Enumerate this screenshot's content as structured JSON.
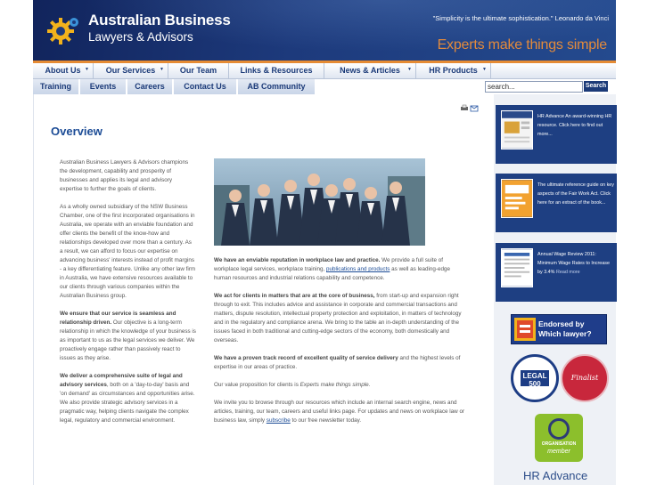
{
  "header": {
    "brand_line1": "Australian Business",
    "brand_line2": "Lawyers & Advisors",
    "quote": "\"Simplicity is the ultimate sophistication.\" Leonardo da Vinci",
    "tagline": "Experts make things simple"
  },
  "nav_primary": [
    {
      "label": "About Us",
      "has_dropdown": true
    },
    {
      "label": "Our Services",
      "has_dropdown": true
    },
    {
      "label": "Our Team",
      "has_dropdown": false
    },
    {
      "label": "Links & Resources",
      "has_dropdown": false
    },
    {
      "label": "News & Articles",
      "has_dropdown": true
    },
    {
      "label": "HR Products",
      "has_dropdown": true
    }
  ],
  "nav_secondary": [
    {
      "label": "Training"
    },
    {
      "label": "Events"
    },
    {
      "label": "Careers"
    },
    {
      "label": "Contact Us"
    },
    {
      "label": "AB Community"
    }
  ],
  "search": {
    "value": "search...",
    "button": "Search"
  },
  "page": {
    "title": "Overview",
    "left_paragraphs": [
      "Australian Business Lawyers & Advisors champions the development, capability and prosperity of businesses and applies its legal and advisory expertise to further the goals of clients.",
      "As a wholly owned subsidiary of the NSW Business Chamber, one of the first incorporated organisations in Australia, we operate with an enviable foundation and offer clients the benefit of the know-how and relationships developed over more than a century. As a result, we can afford to focus our expertise on advancing business' interests instead of profit margins - a key differentiating feature. Unlike any other law firm in Australia, we have extensive resources available to our clients through various companies within the Australian Business group."
    ],
    "left_p3_bold": "We ensure that our service is seamless and relationship driven.",
    "left_p3_rest": " Our objective is a long-term relationship in which the knowledge of your business is as important to us as the legal services we deliver. We proactively engage rather than passively react to issues as they arise.",
    "left_p4_bold": "We deliver a comprehensive suite of legal and advisory services",
    "left_p4_rest": ", both on a 'day-to-day' basis and 'on demand' as circumstances and opportunities arise. We also provide strategic advisory services in a pragmatic way, helping clients navigate the complex legal, regulatory and commercial environment.",
    "right_p1_bold": "We have an enviable reputation in workplace law and practice.",
    "right_p1_a": " We provide a full suite of workplace legal services, workplace training, ",
    "right_p1_link": "publications and products",
    "right_p1_b": " as well as leading-edge human resources and industrial relations capability and competence.",
    "right_p2_bold": "We act for clients in matters that are at the core of business,",
    "right_p2_rest": " from start-up and expansion right through to exit. This includes advice and assistance in corporate and commercial transactions and matters, dispute resolution, intellectual property protection and exploitation, in matters of technology and in the regulatory and compliance arena. We bring to the table an in-depth understanding of the issues faced in both traditional and cutting-edge sectors of the economy, both domestically and overseas.",
    "right_p3_bold": "We have a proven track record of excellent quality of service delivery",
    "right_p3_rest": " and the highest levels of expertise in our areas of practice.",
    "right_p4_a": "Our value proposition for clients is ",
    "right_p4_em": "Experts make things simple.",
    "right_p5_a": "We invite you to browse through our resources which include an internal search engine, news and articles, training, our team, careers and useful links page. For updates and news on workplace law or business law, simply ",
    "right_p5_link": "subscribe",
    "right_p5_b": " to our free newsletter today."
  },
  "sidebar": {
    "promo1": {
      "text": "HR Advance An award-winning HR resource. Click here to find out more..."
    },
    "promo2": {
      "text": "The ultimate reference guide on key aspects of the Fair Work Act. Click here for an extract of the book..."
    },
    "promo3": {
      "text": "Annual Wage Review 2011: Minimum Wage Rates to Increase by 3.4% ",
      "more": "Read more"
    },
    "endorsed_line1": "Endorsed by",
    "endorsed_line2": "Which lawyer?",
    "legal500": "LEGAL 500",
    "finalist": "Finalist",
    "org_label": "ORGANISATION",
    "org_member": "member",
    "hr_advance": "HR Advance"
  },
  "colors": {
    "navy": "#1e3f82",
    "accent_orange": "#e58b34",
    "link_blue": "#1c4c96"
  }
}
